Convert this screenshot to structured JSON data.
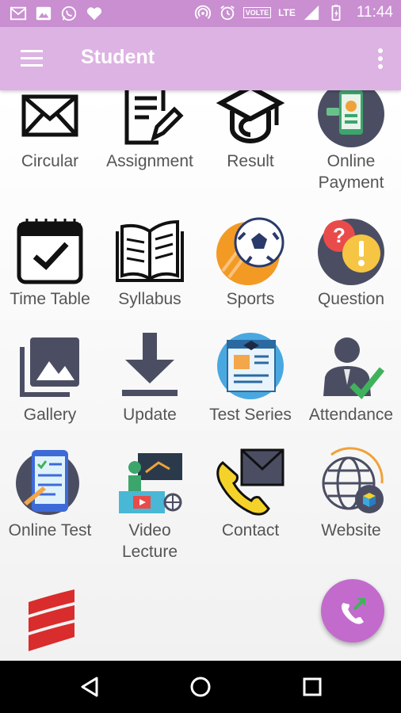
{
  "status_bar": {
    "time": "11:44",
    "network_label": "VOLTE",
    "lte_label": "LTE",
    "left_icons": [
      "gmail-icon",
      "gallery-icon",
      "whatsapp-icon",
      "heart-icon"
    ],
    "right_icons": [
      "hotspot-icon",
      "alarm-icon",
      "volte-icon",
      "signal-icon",
      "battery-icon"
    ]
  },
  "app_bar": {
    "title": "Student",
    "menu_icon": "hamburger-menu-icon",
    "more_icon": "more-vertical-icon"
  },
  "grid": {
    "items": [
      {
        "label": "Circular",
        "icon": "envelope-icon"
      },
      {
        "label": "Assignment",
        "icon": "document-pen-icon"
      },
      {
        "label": "Result",
        "icon": "graduation-cap-icon"
      },
      {
        "label": "Online Payment",
        "icon": "mobile-payment-icon"
      },
      {
        "label": "Time Table",
        "icon": "calendar-check-icon"
      },
      {
        "label": "Syllabus",
        "icon": "open-book-icon"
      },
      {
        "label": "Sports",
        "icon": "soccer-ball-icon"
      },
      {
        "label": "Question",
        "icon": "question-exclamation-icon"
      },
      {
        "label": "Gallery",
        "icon": "gallery-icon"
      },
      {
        "label": "Update",
        "icon": "download-icon"
      },
      {
        "label": "Test Series",
        "icon": "test-series-icon"
      },
      {
        "label": "Attendance",
        "icon": "person-check-icon"
      },
      {
        "label": "Online Test",
        "icon": "online-test-icon"
      },
      {
        "label": "Video Lecture",
        "icon": "video-lecture-icon"
      },
      {
        "label": "Contact",
        "icon": "phone-mail-icon"
      },
      {
        "label": "Website",
        "icon": "globe-icon"
      },
      {
        "label": "",
        "icon": "red-stack-icon"
      }
    ]
  },
  "fab": {
    "icon": "phone-transfer-icon"
  },
  "nav_bar": {
    "icons": [
      "back-icon",
      "home-icon",
      "recents-icon"
    ]
  },
  "colors": {
    "status_bar": "#c98fd1",
    "app_bar": "#ddb3e3",
    "fab": "#c26bcc",
    "label_text": "#555555"
  }
}
